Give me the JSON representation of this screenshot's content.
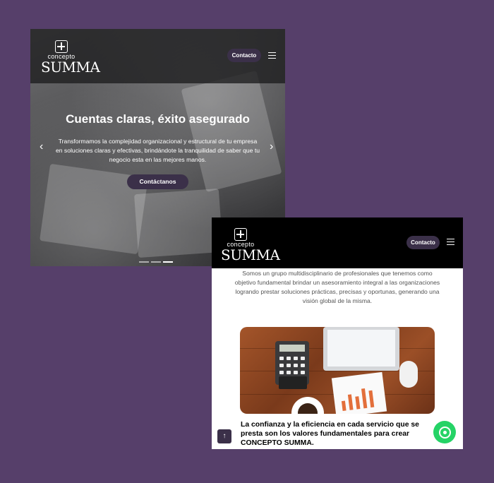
{
  "brand": {
    "logo_small": "concepto",
    "logo_large": "SUMMA"
  },
  "hero": {
    "nav_button": "Contacto",
    "title": "Cuentas claras, éxito asegurado",
    "subtitle": "Transformamos la complejidad organizacional y estructural de tu empresa en soluciones claras y efectivas, brindándote la tranquilidad de saber que tu negocio esta en las mejores manos.",
    "cta_button": "Contáctanos",
    "prev_arrow": "‹",
    "next_arrow": "›",
    "slides_count": 3,
    "active_slide": 3
  },
  "about": {
    "nav_button": "Contacto",
    "description": "Somos un grupo multidisciplinario de profesionales que tenemos como objetivo fundamental brindar un asesoramiento integral a las organizaciones logrando prestar soluciones prácticas, precisas y oportunas, generando una visión global de la misma.",
    "tagline": "La confianza y la eficiencia en cada servicio que se presta son los valores fundamentales para crear CONCEPTO SUMMA.",
    "scroll_top_icon": "↑"
  },
  "colors": {
    "page_background": "#563f6a",
    "button_background": "#3b3049",
    "whatsapp": "#25d366"
  },
  "icons": {
    "menu": "hamburger-icon",
    "whatsapp": "whatsapp-icon",
    "scroll_top": "arrow-up-icon"
  }
}
